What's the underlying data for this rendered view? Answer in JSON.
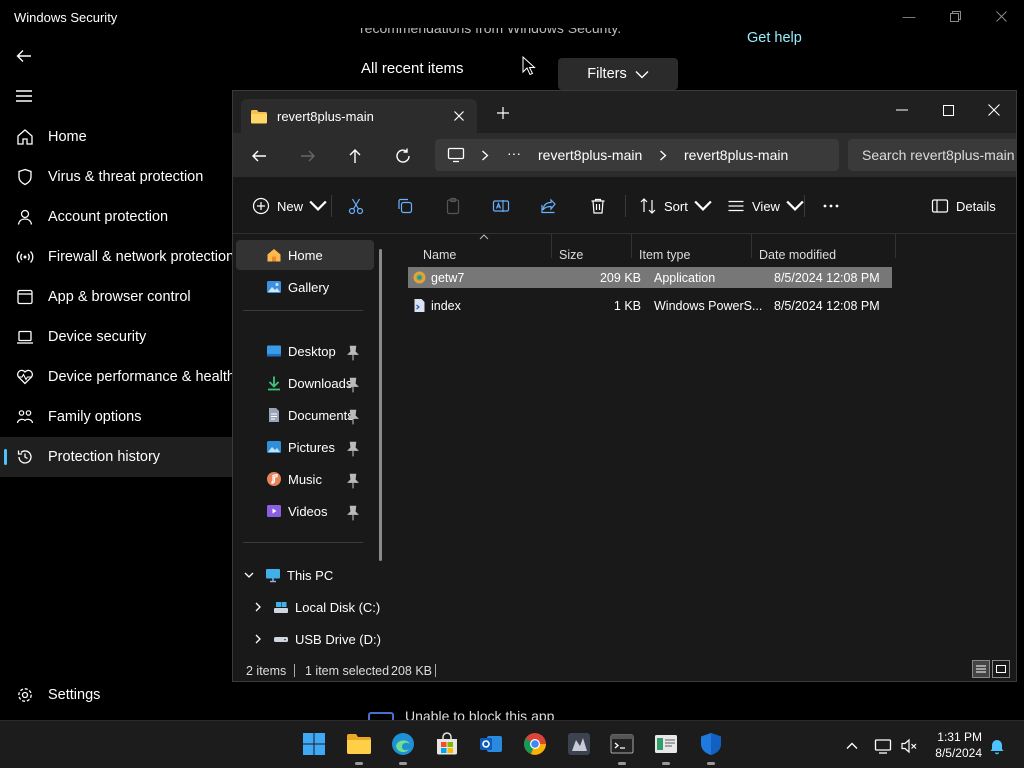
{
  "security": {
    "title": "Windows Security",
    "nav": [
      {
        "label": "Home",
        "icon": "home-icon"
      },
      {
        "label": "Virus & threat protection",
        "icon": "shield-icon"
      },
      {
        "label": "Account protection",
        "icon": "person-icon"
      },
      {
        "label": "Firewall & network protection",
        "icon": "antenna-icon"
      },
      {
        "label": "App & browser control",
        "icon": "app-window-icon"
      },
      {
        "label": "Device security",
        "icon": "laptop-icon"
      },
      {
        "label": "Device performance & health",
        "icon": "heart-icon"
      },
      {
        "label": "Family options",
        "icon": "family-icon"
      },
      {
        "label": "Protection history",
        "icon": "history-icon"
      }
    ],
    "active_nav": "Protection history",
    "settings": "Settings",
    "cut_text": "recommendations from Windows Security.",
    "get_help": "Get help",
    "all_recent": "All recent items",
    "filters": "Filters",
    "unable": "Unable to block this app",
    "accent": "#4cc2ff"
  },
  "explorer": {
    "tab_title": "revert8plus-main",
    "breadcrumb": [
      "revert8plus-main",
      "revert8plus-main"
    ],
    "search_placeholder": "Search revert8plus-main",
    "toolbar": {
      "new": "New",
      "sort": "Sort",
      "view": "View",
      "details": "Details"
    },
    "nav_pane": {
      "home": "Home",
      "gallery": "Gallery",
      "quick": [
        "Desktop",
        "Downloads",
        "Documents",
        "Pictures",
        "Music",
        "Videos"
      ],
      "this_pc": "This PC",
      "drives": [
        "Local Disk (C:)",
        "USB Drive (D:)"
      ]
    },
    "columns": {
      "name": "Name",
      "size": "Size",
      "type": "Item type",
      "date": "Date modified"
    },
    "files": [
      {
        "name": "getw7",
        "size": "209 KB",
        "type": "Application",
        "date": "8/5/2024 12:08 PM",
        "selected": true
      },
      {
        "name": "index",
        "size": "1 KB",
        "type": "Windows PowerS...",
        "date": "8/5/2024 12:08 PM",
        "selected": false
      }
    ],
    "status": {
      "items": "2 items",
      "selected": "1 item selected",
      "size": "208 KB"
    }
  },
  "taskbar": {
    "time": "1:31 PM",
    "date": "8/5/2024"
  }
}
